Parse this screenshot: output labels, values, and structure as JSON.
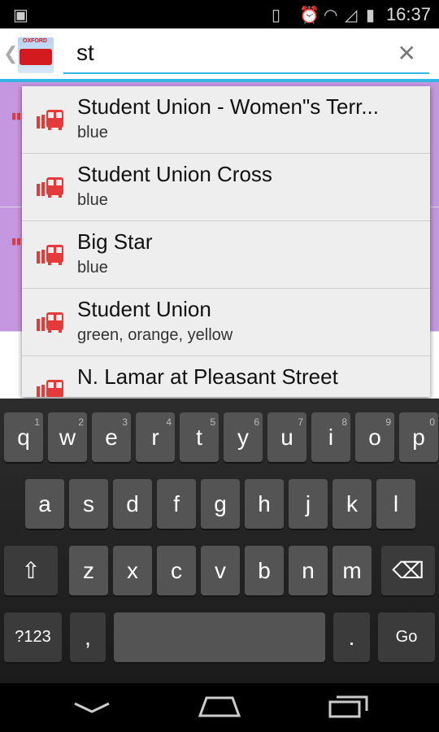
{
  "status": {
    "time": "16:37",
    "icons": [
      "image-icon",
      "vibrate-icon",
      "alarm-icon",
      "wifi-icon",
      "signal-icon",
      "battery-icon"
    ]
  },
  "appbar": {
    "logo_text": "OXFORD",
    "logo_badge": "Free",
    "search_value": "st"
  },
  "suggestions": [
    {
      "name": "Student Union - Women\"s Terr...",
      "routes": "blue"
    },
    {
      "name": "Student Union Cross",
      "routes": "blue"
    },
    {
      "name": "Big Star",
      "routes": "blue"
    },
    {
      "name": "Student Union",
      "routes": "green, orange, yellow"
    },
    {
      "name": "N. Lamar at Pleasant Street",
      "routes": ""
    }
  ],
  "keyboard": {
    "row1": [
      [
        "q",
        "1"
      ],
      [
        "w",
        "2"
      ],
      [
        "e",
        "3"
      ],
      [
        "r",
        "4"
      ],
      [
        "t",
        "5"
      ],
      [
        "y",
        "6"
      ],
      [
        "u",
        "7"
      ],
      [
        "i",
        "8"
      ],
      [
        "o",
        "9"
      ],
      [
        "p",
        "0"
      ]
    ],
    "row2": [
      "a",
      "s",
      "d",
      "f",
      "g",
      "h",
      "j",
      "k",
      "l"
    ],
    "row3": [
      "z",
      "x",
      "c",
      "v",
      "b",
      "n",
      "m"
    ],
    "symbols": "?123",
    "comma": ",",
    "period": ".",
    "go": "Go"
  },
  "colors": {
    "accent": "#33b5e5",
    "list_bg": "#c597e0",
    "bus_icon": "#e53a3a"
  }
}
